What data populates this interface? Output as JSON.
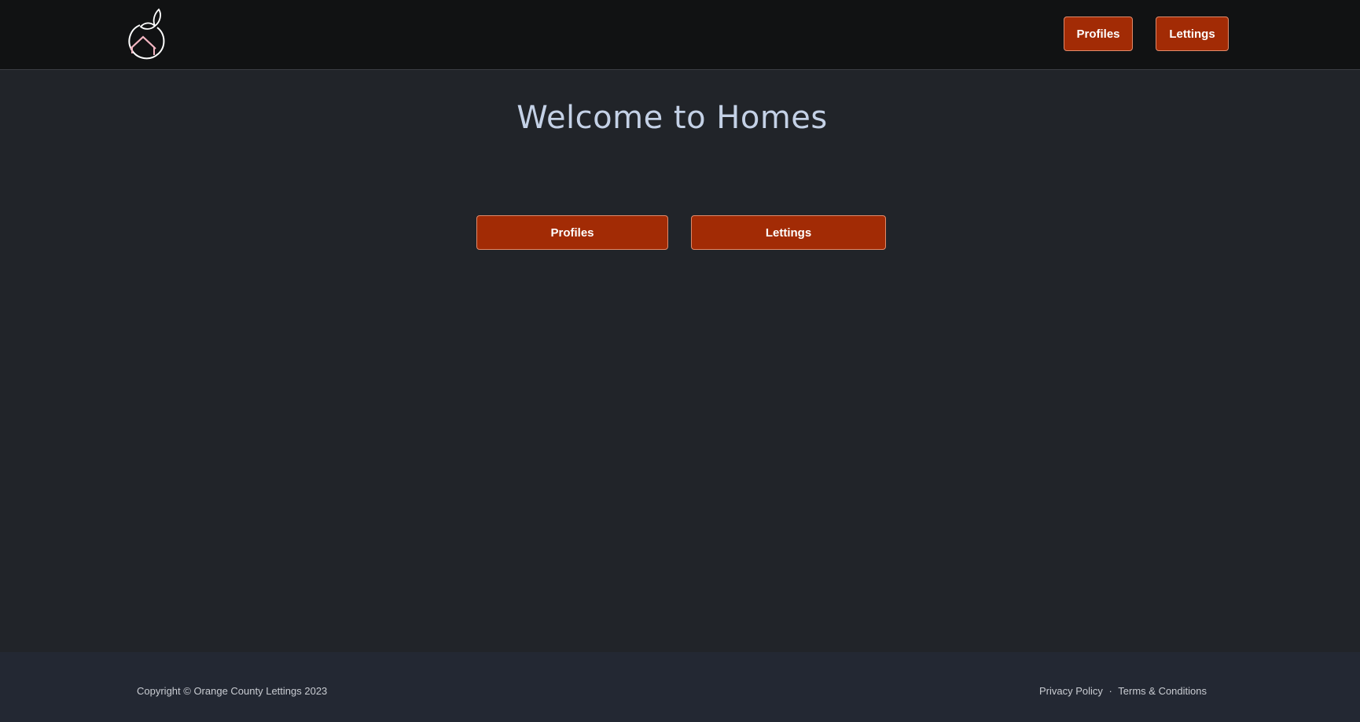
{
  "header": {
    "logo_icon": "orange-house-logo-icon",
    "nav": {
      "profiles_label": "Profiles",
      "lettings_label": "Lettings"
    }
  },
  "main": {
    "title": "Welcome to Homes",
    "buttons": {
      "profiles_label": "Profiles",
      "lettings_label": "Lettings"
    }
  },
  "footer": {
    "copyright": "Copyright © Orange County Lettings 2023",
    "privacy_label": "Privacy Policy",
    "separator": "·",
    "terms_label": "Terms & Conditions"
  },
  "colors": {
    "header_bg": "#111213",
    "page_bg": "#212429",
    "footer_bg": "#232833",
    "button_bg": "#a22b05",
    "button_border": "#e08a6a",
    "title_color": "#c4d1e6"
  }
}
